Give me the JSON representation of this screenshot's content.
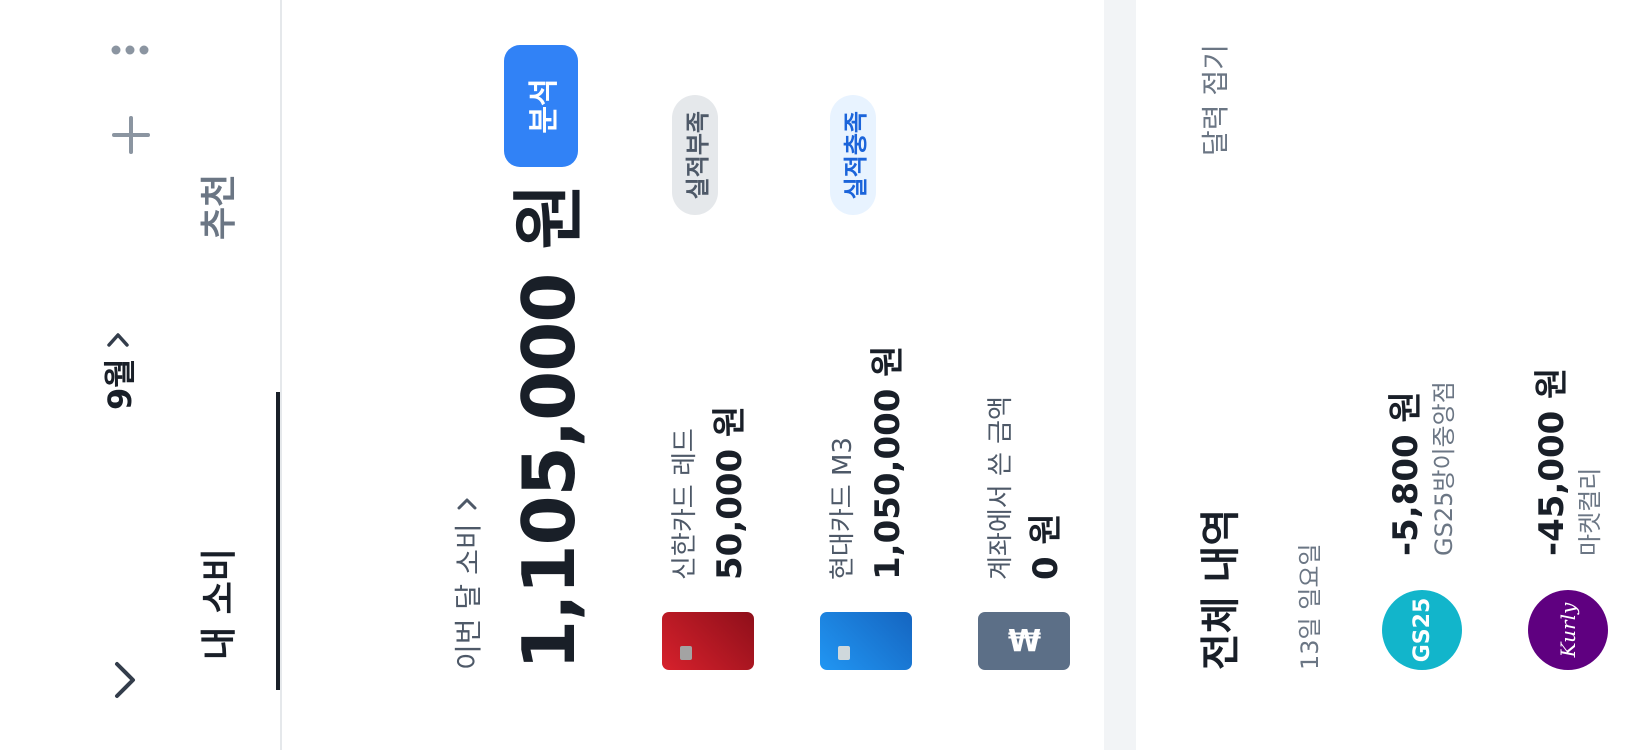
{
  "header": {
    "month_label": "9월",
    "icons": [
      "chevron-down-icon",
      "chevron-right-icon",
      "plus-icon",
      "more-vertical-icon"
    ]
  },
  "tabs": [
    {
      "label": "내 소비",
      "active": true
    },
    {
      "label": "추천",
      "active": false
    }
  ],
  "summary": {
    "label": "이번 달 소비",
    "total": "1,105,000 원",
    "analyze_label": "분석"
  },
  "cards": [
    {
      "name": "신한카드 레드",
      "amount": "50,000 원",
      "badge": "실적부족",
      "badge_bg": "#e5e8eb",
      "badge_fg": "#4e5968",
      "card_color": "#c81e2b"
    },
    {
      "name": "현대카드 M3",
      "amount": "1,050,000 원",
      "badge": "실적충족",
      "badge_bg": "#e8f3ff",
      "badge_fg": "#1b64da",
      "card_color": "#1e88e5"
    },
    {
      "name": "계좌에서 쓴 금액",
      "amount": "0 원",
      "badge": "",
      "card_color": "#5c6f87"
    }
  ],
  "transactions": {
    "title": "전체 내역",
    "toggle_label": "달력 접기",
    "date_label": "13일 일요일",
    "items": [
      {
        "amount": "-5,800 원",
        "merchant": "GS25방이중앙점",
        "logo_text": "GS25",
        "logo_bg": "#12b5cb"
      },
      {
        "amount": "-45,000 원",
        "merchant": "마켓컬리",
        "logo_text": "Kurly",
        "logo_bg": "#5f0080"
      }
    ]
  },
  "colors": {
    "accent": "#3182f6",
    "text_primary": "#191f28",
    "text_secondary": "#6b7684"
  }
}
